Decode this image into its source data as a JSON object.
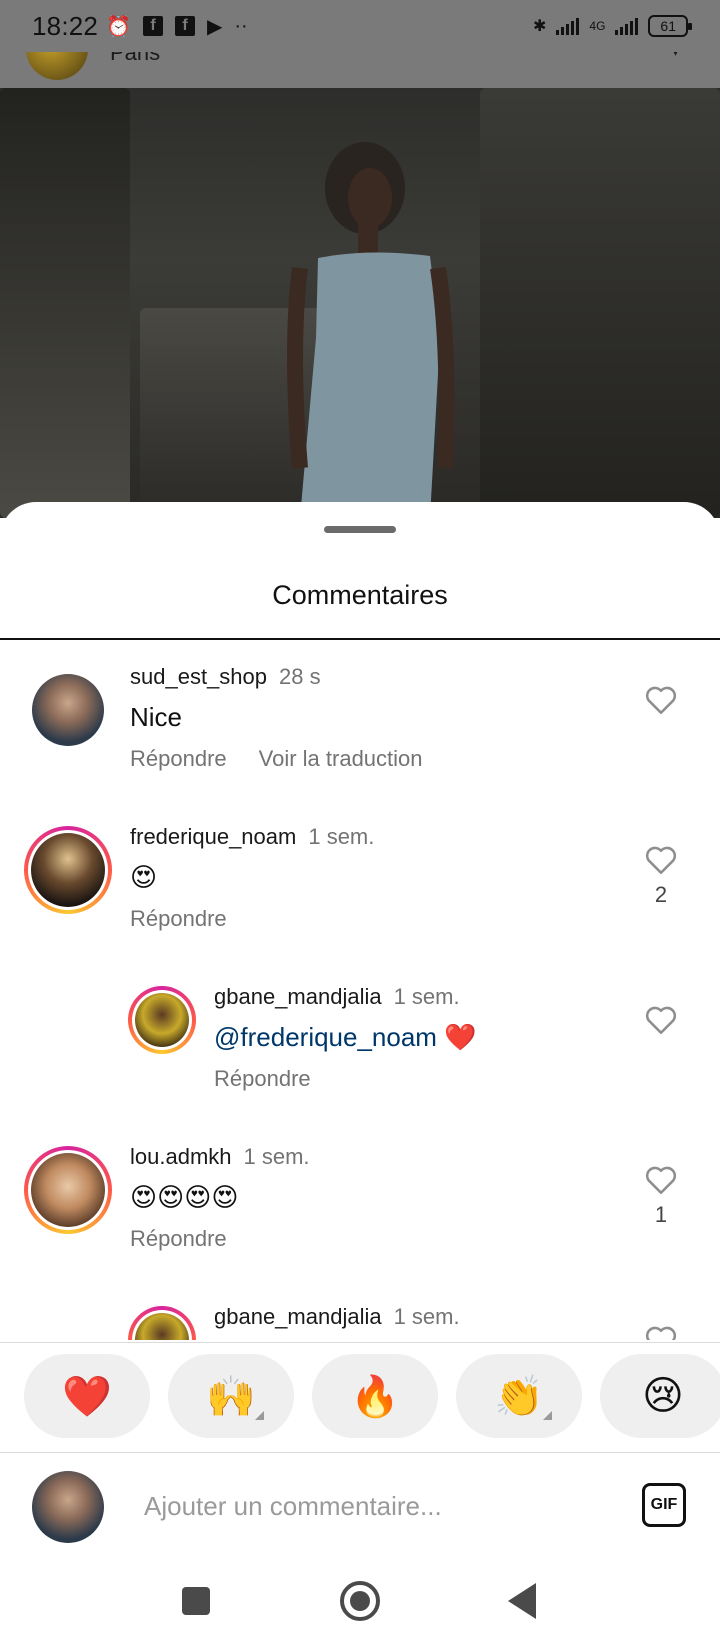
{
  "status_bar": {
    "time": "18:22",
    "network": "4G",
    "battery": "61"
  },
  "post_header": {
    "location": "Paris"
  },
  "sheet": {
    "title": "Commentaires"
  },
  "comments": [
    {
      "username": "sud_est_shop",
      "time": "28 s",
      "text": "Nice",
      "reply_label": "Répondre",
      "translate_label": "Voir la traduction",
      "likes": ""
    },
    {
      "username": "frederique_noam",
      "time": "1 sem.",
      "text": "😍",
      "reply_label": "Répondre",
      "likes": "2"
    },
    {
      "username": "gbane_mandjalia",
      "time": "1 sem.",
      "mention": "@frederique_noam",
      "text": "❤️",
      "reply_label": "Répondre",
      "likes": ""
    },
    {
      "username": "lou.admkh",
      "time": "1 sem.",
      "text": "😍😍😍😍",
      "reply_label": "Répondre",
      "likes": "1"
    },
    {
      "username": "gbane_mandjalia",
      "time": "1 sem."
    }
  ],
  "reactions": [
    "❤️",
    "🙌",
    "🔥",
    "👏",
    "😢"
  ],
  "composer": {
    "placeholder": "Ajouter un commentaire...",
    "gif_label": "GIF"
  },
  "colors": {
    "accent_mention": "#00376b",
    "secondary_text": "#737373",
    "reaction_bg": "#efefef"
  }
}
